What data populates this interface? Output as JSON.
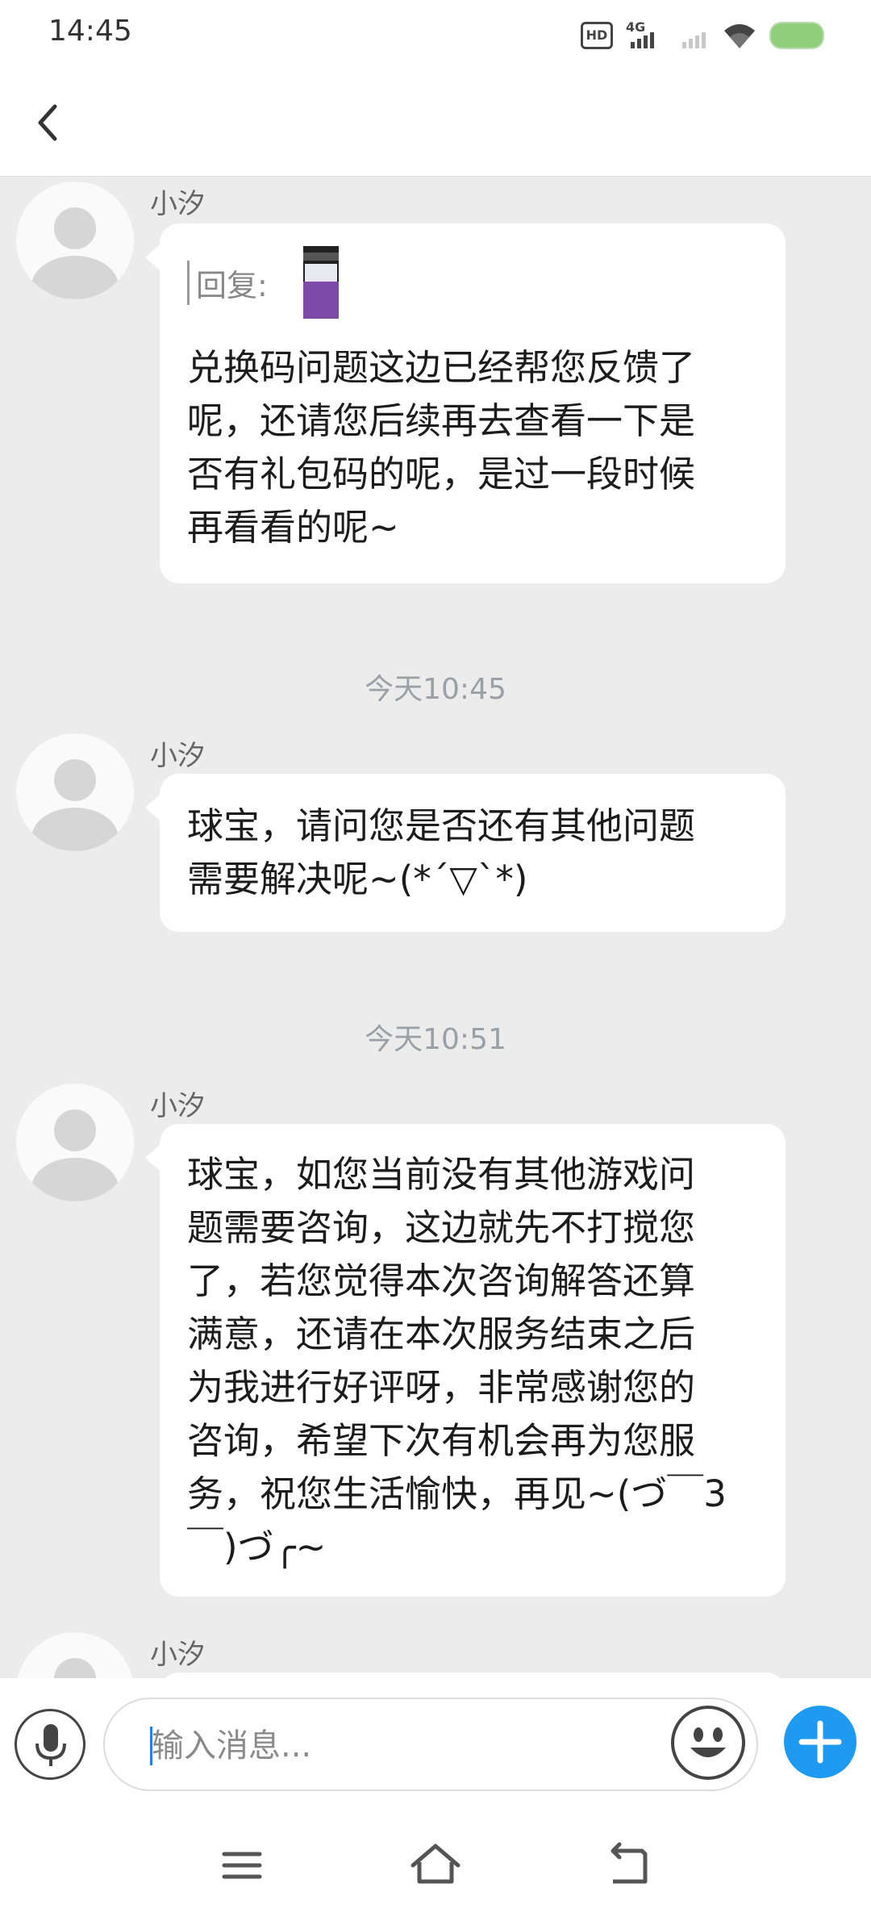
{
  "status_bar": {
    "time": "14:45",
    "hd": "HD",
    "network": "4G"
  },
  "header": {
    "back_icon": "chevron-left-icon"
  },
  "messages": [
    {
      "type": "incoming",
      "sender": "小汐",
      "reply_label": "回复:",
      "text": "兑换码问题这边已经帮您反馈了\n呢，还请您后续再去查看一下是\n否有礼包码的呢，是过一段时候\n再看看的呢~"
    },
    {
      "type": "timestamp",
      "text": "今天10:45"
    },
    {
      "type": "incoming",
      "sender": "小汐",
      "text": "球宝，请问您是否还有其他问题\n需要解决呢~(*ˊ▽ˋ*)"
    },
    {
      "type": "timestamp",
      "text": "今天10:51"
    },
    {
      "type": "incoming",
      "sender": "小汐",
      "text": "球宝，如您当前没有其他游戏问\n题需要咨询，这边就先不打搅您\n了，若您觉得本次咨询解答还算\n满意，还请在本次服务结束之后\n为我进行好评呀，非常感谢您的\n咨询，希望下次有机会再为您服\n务，祝您生活愉快，再见~(づ￣3\n￣)づ╭~"
    },
    {
      "type": "incoming",
      "sender": "小汐",
      "text": ""
    }
  ],
  "input_bar": {
    "placeholder": "输入消息...",
    "value": ""
  },
  "icons": {
    "mic": "microphone-icon",
    "emoji": "emoji-icon",
    "add": "plus-icon"
  },
  "colors": {
    "accent": "#1e9bf0",
    "chat_bg": "#ececec",
    "battery": "#8fce7b"
  }
}
